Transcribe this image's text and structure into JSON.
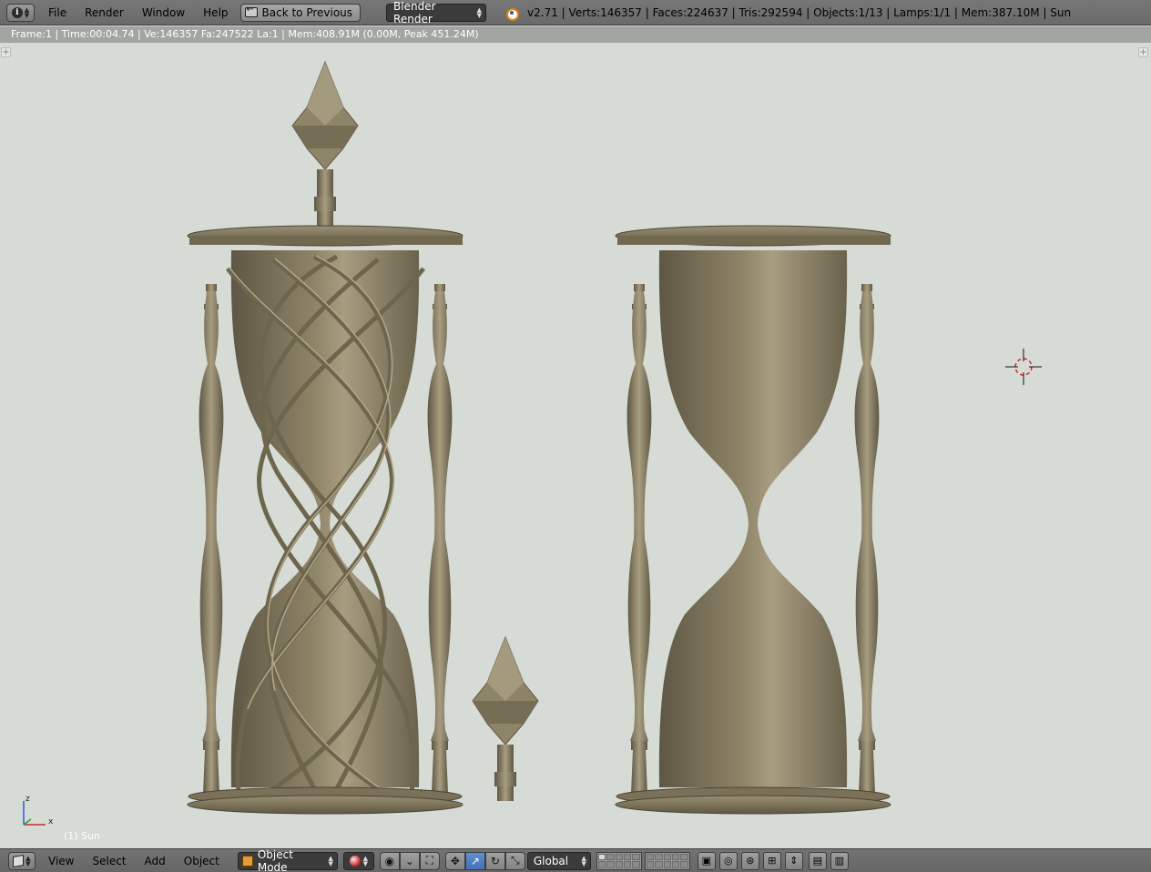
{
  "header": {
    "editor_type_icon": "info-icon",
    "menus": [
      "File",
      "Render",
      "Window",
      "Help"
    ],
    "back_button": "Back to Previous",
    "render_engine": "Blender Render",
    "stats": "v2.71 | Verts:146357 | Faces:224637 | Tris:292594 | Objects:1/13 | Lamps:1/1 | Mem:387.10M | Sun"
  },
  "viewport": {
    "render_info": "Frame:1 | Time:00:04.74 | Ve:146357 Fa:247522 La:1 | Mem:408.91M (0.00M, Peak 451.24M)",
    "axis_labels": {
      "z": "z",
      "x": "x"
    },
    "active_object": "(1) Sun",
    "colors": {
      "background": "#d6dbd6",
      "model": "#8a8064",
      "model_dark": "#5e5744",
      "model_light": "#a89d80"
    }
  },
  "view3d_header": {
    "editor_type_icon": "cube-icon",
    "menus": [
      "View",
      "Select",
      "Add",
      "Object"
    ],
    "mode": "Object Mode",
    "viewport_shading": "solid-shading-icon",
    "orientation": "Global"
  }
}
